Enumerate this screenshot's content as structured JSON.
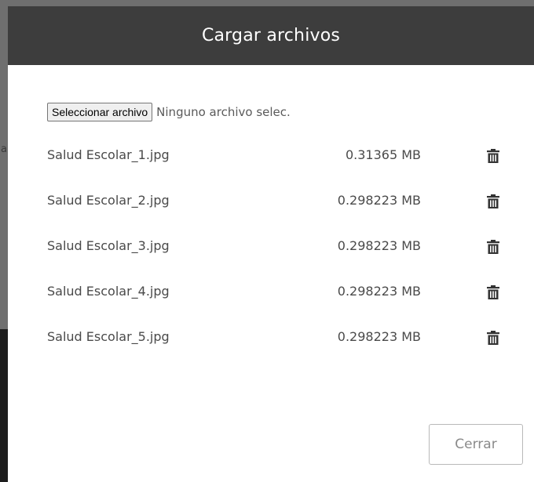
{
  "backdrop": {
    "partial_text": "a"
  },
  "modal": {
    "title": "Cargar archivos",
    "file_picker": {
      "button_label": "Seleccionar archivo",
      "status_text": "Ninguno archivo selec."
    },
    "files": [
      {
        "name": "Salud Escolar_1.jpg",
        "size": "0.31365 MB",
        "delete_icon": "trash-icon"
      },
      {
        "name": "Salud Escolar_2.jpg",
        "size": "0.298223 MB",
        "delete_icon": "trash-icon"
      },
      {
        "name": "Salud Escolar_3.jpg",
        "size": "0.298223 MB",
        "delete_icon": "trash-icon"
      },
      {
        "name": "Salud Escolar_4.jpg",
        "size": "0.298223 MB",
        "delete_icon": "trash-icon"
      },
      {
        "name": "Salud Escolar_5.jpg",
        "size": "0.298223 MB",
        "delete_icon": "trash-icon"
      }
    ],
    "close_label": "Cerrar"
  },
  "colors": {
    "header_bg": "#3d3d3d",
    "header_text": "#ffffff",
    "body_bg": "#ffffff",
    "text": "#4a4a4a",
    "backdrop": "#6f6f6f"
  }
}
